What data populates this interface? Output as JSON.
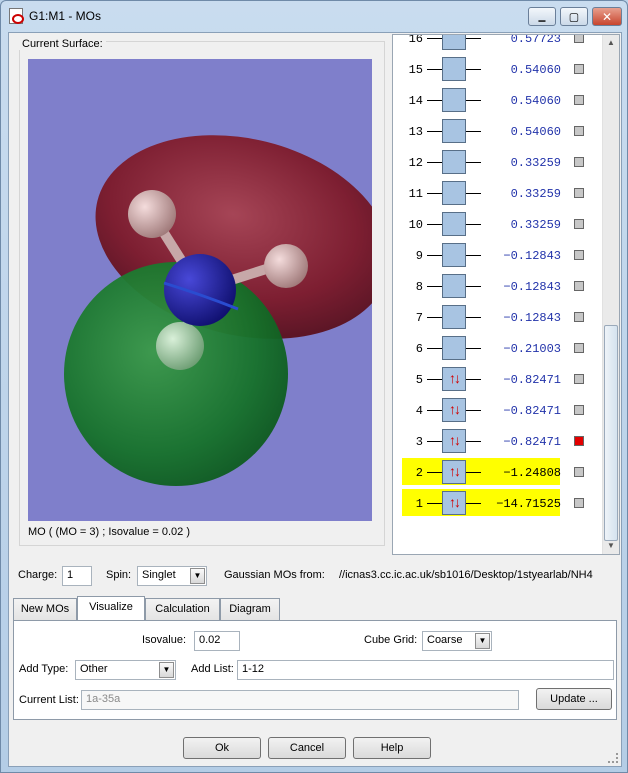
{
  "window": {
    "title": "G1:M1 - MOs",
    "close_glyph": "✕",
    "minimize_glyph": "▁",
    "maximize_glyph": "▢"
  },
  "surface": {
    "group_label": "Current Surface:",
    "status": "MO ( (MO = 3) ; Isovalue = 0.02 )"
  },
  "mo_list": [
    {
      "n": "16",
      "energy": "0.57723",
      "occupied": false,
      "highlight": false,
      "selected": false
    },
    {
      "n": "15",
      "energy": "0.54060",
      "occupied": false,
      "highlight": false,
      "selected": false
    },
    {
      "n": "14",
      "energy": "0.54060",
      "occupied": false,
      "highlight": false,
      "selected": false
    },
    {
      "n": "13",
      "energy": "0.54060",
      "occupied": false,
      "highlight": false,
      "selected": false
    },
    {
      "n": "12",
      "energy": "0.33259",
      "occupied": false,
      "highlight": false,
      "selected": false
    },
    {
      "n": "11",
      "energy": "0.33259",
      "occupied": false,
      "highlight": false,
      "selected": false
    },
    {
      "n": "10",
      "energy": "0.33259",
      "occupied": false,
      "highlight": false,
      "selected": false
    },
    {
      "n": "9",
      "energy": "−0.12843",
      "occupied": false,
      "highlight": false,
      "selected": false
    },
    {
      "n": "8",
      "energy": "−0.12843",
      "occupied": false,
      "highlight": false,
      "selected": false
    },
    {
      "n": "7",
      "energy": "−0.12843",
      "occupied": false,
      "highlight": false,
      "selected": false
    },
    {
      "n": "6",
      "energy": "−0.21003",
      "occupied": false,
      "highlight": false,
      "selected": false
    },
    {
      "n": "5",
      "energy": "−0.82471",
      "occupied": true,
      "highlight": false,
      "selected": false
    },
    {
      "n": "4",
      "energy": "−0.82471",
      "occupied": true,
      "highlight": false,
      "selected": false
    },
    {
      "n": "3",
      "energy": "−0.82471",
      "occupied": true,
      "highlight": false,
      "selected": true
    },
    {
      "n": "2",
      "energy": "−1.24808",
      "occupied": true,
      "highlight": true,
      "selected": false
    },
    {
      "n": "1",
      "energy": "−14.71525",
      "occupied": true,
      "highlight": true,
      "selected": false
    }
  ],
  "electron_arrows": "↑↓",
  "settings": {
    "charge_label": "Charge:",
    "charge_value": "1",
    "spin_label": "Spin:",
    "spin_value": "Singlet",
    "source_label": "Gaussian MOs from:",
    "source_path": "//icnas3.cc.ic.ac.uk/sb1016/Desktop/1styearlab/NH4"
  },
  "tabs": [
    "New MOs",
    "Visualize",
    "Calculation",
    "Diagram"
  ],
  "visualize": {
    "isovalue_label": "Isovalue:",
    "isovalue": "0.02",
    "cube_grid_label": "Cube Grid:",
    "cube_grid": "Coarse",
    "add_type_label": "Add Type:",
    "add_type": "Other",
    "add_list_label": "Add List:",
    "add_list": "1-12",
    "current_list_label": "Current List:",
    "current_list_placeholder": "1a-35a",
    "update_label": "Update ..."
  },
  "buttons": {
    "ok": "Ok",
    "cancel": "Cancel",
    "help": "Help"
  },
  "colors": {
    "viewer_bg": "#7f7fcb",
    "positive_lobe": "#8c1a2a",
    "negative_lobe": "#1c7a2b",
    "highlight": "#ffff00"
  }
}
